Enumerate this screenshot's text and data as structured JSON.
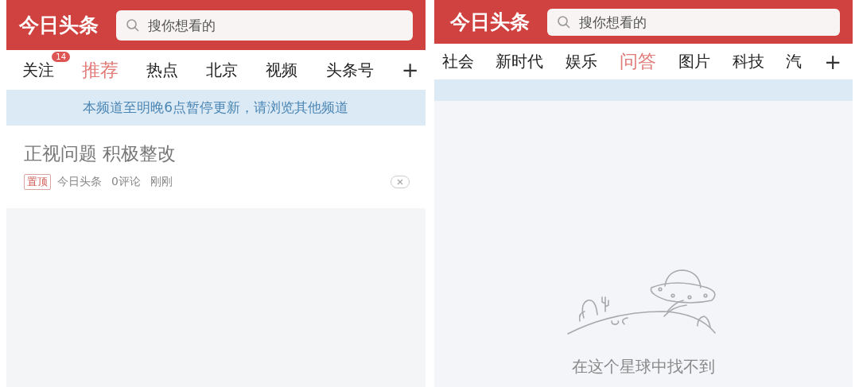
{
  "panels": [
    {
      "logo": "今日头条",
      "search": {
        "placeholder": "搜你想看的"
      },
      "tabs": [
        {
          "label": "关注",
          "selected": false,
          "badge": "14"
        },
        {
          "label": "推荐",
          "selected": true
        },
        {
          "label": "热点",
          "selected": false
        },
        {
          "label": "北京",
          "selected": false
        },
        {
          "label": "视频",
          "selected": false
        },
        {
          "label": "头条号",
          "selected": false
        }
      ],
      "plus": "+",
      "notice": "本频道至明晚6点暂停更新，请浏览其他频道",
      "articles": [
        {
          "title": "正视问题 积极整改",
          "tag": "置顶",
          "source": "今日头条",
          "comments": "0评论",
          "time": "刚刚"
        }
      ]
    },
    {
      "logo": "今日头条",
      "search": {
        "placeholder": "搜你想看的"
      },
      "tabs": [
        {
          "label": "社会",
          "selected": false
        },
        {
          "label": "新时代",
          "selected": false
        },
        {
          "label": "娱乐",
          "selected": false
        },
        {
          "label": "问答",
          "selected": true
        },
        {
          "label": "图片",
          "selected": false
        },
        {
          "label": "科技",
          "selected": false
        },
        {
          "label": "汽",
          "selected": false
        }
      ],
      "plus": "+",
      "empty_message": "在这个星球中找不到"
    }
  ]
}
